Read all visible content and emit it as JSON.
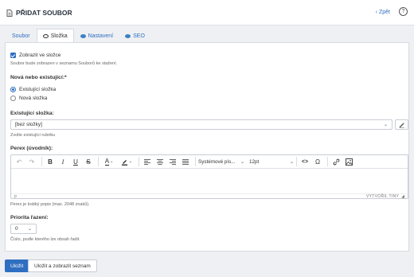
{
  "header": {
    "title": "PŘIDAT SOUBOR",
    "back_label": "‹ Zpět",
    "help_label": "?"
  },
  "tabs": [
    {
      "label": "Soubor",
      "icon": "none",
      "active": false
    },
    {
      "label": "Složka",
      "icon": "toggle-icon",
      "active": true
    },
    {
      "label": "Nastavení",
      "icon": "toggle-icon",
      "active": false
    },
    {
      "label": "SEO",
      "icon": "toggle-icon",
      "active": false
    }
  ],
  "form": {
    "show_in_folder": {
      "label": "Zobrazit ve složce",
      "checked": true,
      "hint": "Soubor bude zobrazen v seznamu Souborů ke stažení."
    },
    "folder_choice": {
      "label": "Nová nebo existující:*",
      "options": [
        {
          "label": "Existující složka",
          "selected": true
        },
        {
          "label": "Nová složka",
          "selected": false
        }
      ]
    },
    "existing_folder": {
      "label": "Existující složka:",
      "value": "[bez složky]",
      "hint": "Zvolte existující rubriku"
    },
    "perex": {
      "label": "Perex (úvodník):",
      "font_family": "Systémové pís...",
      "font_size": "12pt",
      "status_path": "p",
      "branding": "VYTVOŘIL TINY",
      "hint": "Perex je krátký popis (max. 2048 znaků)."
    },
    "priority": {
      "label": "Priorita řazení:",
      "value": "0",
      "hint": "Číslo, podle kterého lze obsah řadit."
    }
  },
  "actions": {
    "save_label": "Uložit",
    "save_and_list_label": "Uložit a zobrazit seznam"
  },
  "colors": {
    "accent": "#2f6fc1",
    "background": "#eef0f3"
  }
}
